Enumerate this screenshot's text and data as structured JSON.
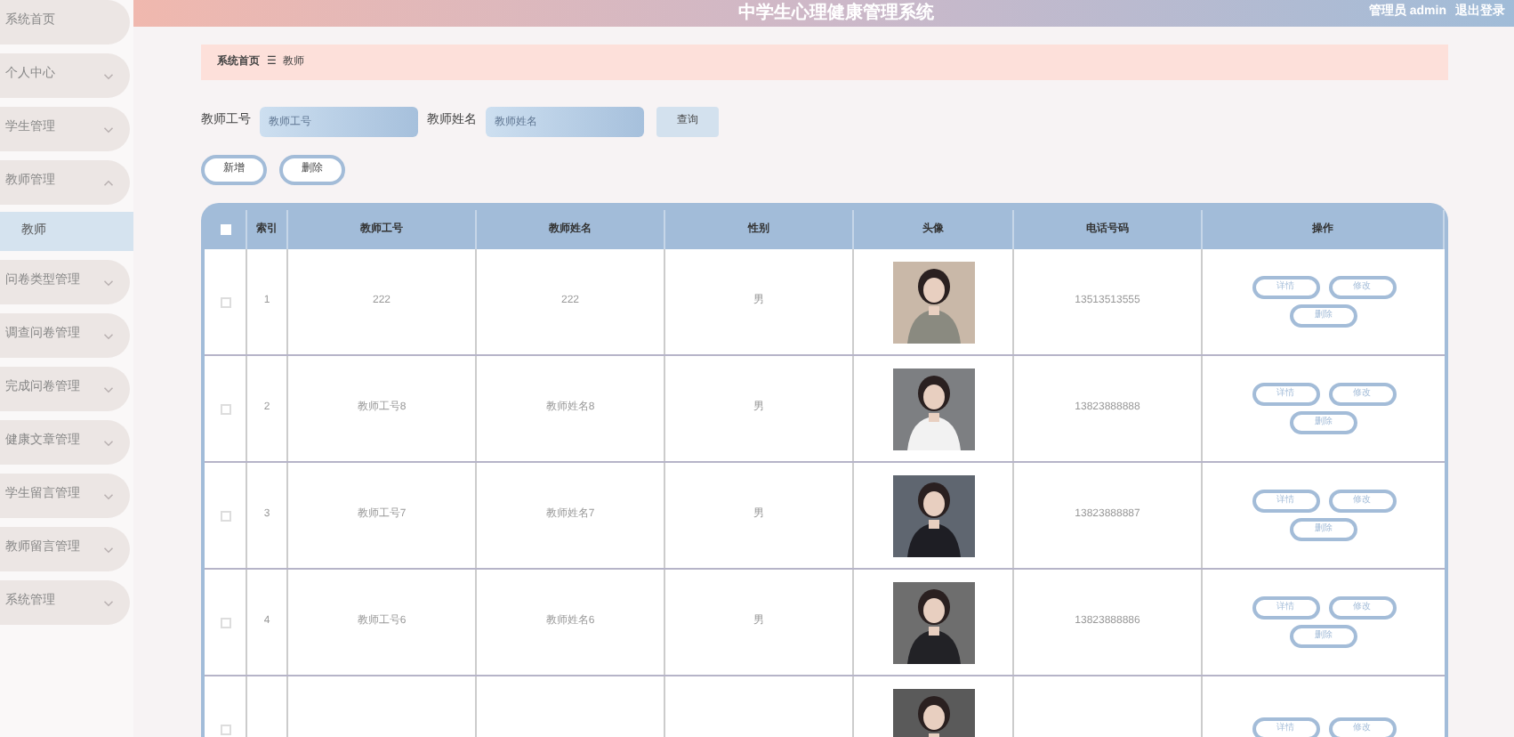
{
  "header": {
    "title": "中学生心理健康管理系统",
    "user": "管理员 admin",
    "logout": "退出登录"
  },
  "sidebar": {
    "items": [
      {
        "label": "系统首页",
        "has_arrow": false,
        "expanded": false
      },
      {
        "label": "个人中心",
        "has_arrow": true,
        "expanded": false
      },
      {
        "label": "学生管理",
        "has_arrow": true,
        "expanded": false
      },
      {
        "label": "教师管理",
        "has_arrow": true,
        "expanded": true,
        "children": [
          {
            "label": "教师",
            "selected": true
          }
        ]
      },
      {
        "label": "问卷类型管理",
        "has_arrow": true,
        "expanded": false
      },
      {
        "label": "调查问卷管理",
        "has_arrow": true,
        "expanded": false
      },
      {
        "label": "完成问卷管理",
        "has_arrow": true,
        "expanded": false
      },
      {
        "label": "健康文章管理",
        "has_arrow": true,
        "expanded": false
      },
      {
        "label": "学生留言管理",
        "has_arrow": true,
        "expanded": false
      },
      {
        "label": "教师留言管理",
        "has_arrow": true,
        "expanded": false
      },
      {
        "label": "系统管理",
        "has_arrow": true,
        "expanded": false
      }
    ]
  },
  "breadcrumb": {
    "home": "系统首页",
    "separator": "☰",
    "current": "教师"
  },
  "search": {
    "fields": [
      {
        "label": "教师工号",
        "placeholder": "教师工号"
      },
      {
        "label": "教师姓名",
        "placeholder": "教师姓名"
      }
    ],
    "button": "查询"
  },
  "actions": [
    "新增",
    "删除"
  ],
  "table": {
    "select_all_checked": false,
    "columns": [
      "",
      "索引",
      "教师工号",
      "教师姓名",
      "性别",
      "头像",
      "电话号码",
      "操作"
    ],
    "rows": [
      {
        "checked": false,
        "index": "1",
        "id": "222",
        "name": "222",
        "gender": "男",
        "phone": "13513513555",
        "actions": [
          "详情",
          "修改",
          "删除"
        ]
      },
      {
        "checked": false,
        "index": "2",
        "id": "教师工号8",
        "name": "教师姓名8",
        "gender": "男",
        "phone": "13823888888",
        "actions": [
          "详情",
          "修改",
          "删除"
        ]
      },
      {
        "checked": false,
        "index": "3",
        "id": "教师工号7",
        "name": "教师姓名7",
        "gender": "男",
        "phone": "13823888887",
        "actions": [
          "详情",
          "修改",
          "删除"
        ]
      },
      {
        "checked": false,
        "index": "4",
        "id": "教师工号6",
        "name": "教师姓名6",
        "gender": "男",
        "phone": "13823888886",
        "actions": [
          "详情",
          "修改",
          "删除"
        ]
      },
      {
        "checked": false,
        "actions": [
          "详情",
          "修改"
        ]
      }
    ]
  }
}
